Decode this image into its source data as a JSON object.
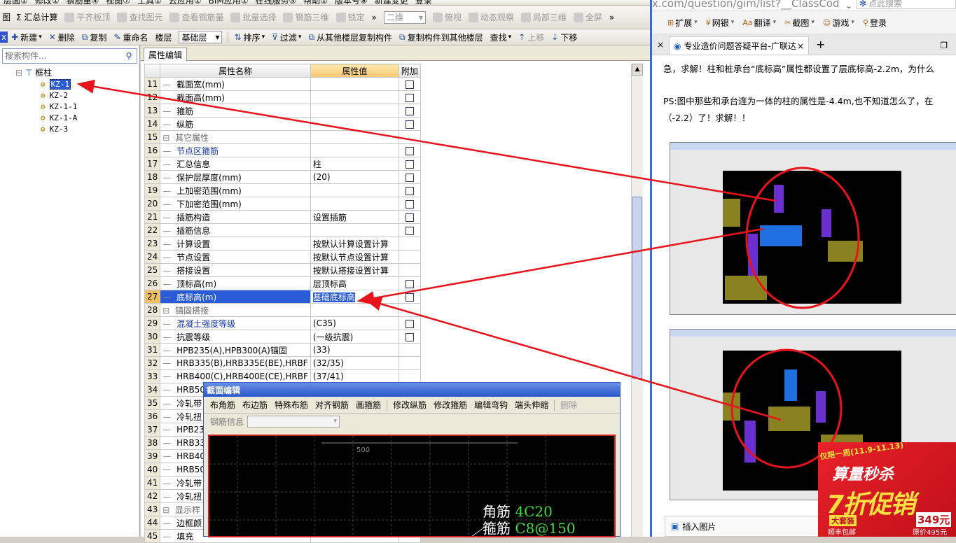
{
  "menu": [
    "层面①",
    "修改①",
    "钢筋量④",
    "视图⑦",
    "工具①",
    "云应用①",
    "BIM应用①",
    "在线服务⑤",
    "帮助①",
    "版本号⑧",
    "新建变更",
    "登录"
  ],
  "toolbar1": {
    "items": [
      "Σ 汇总计算",
      "平齐板顶",
      "查找图元",
      "查看钢筋量",
      "批量选择",
      "钢筋三维",
      "锁定"
    ],
    "view_select": "二维",
    "items2": [
      "俯视",
      "动态观察",
      "局部三维",
      "全屏"
    ],
    "left_glyph": "图"
  },
  "toolbar2": {
    "items": [
      "新建",
      "删除",
      "复制",
      "重命名"
    ],
    "floor_label": "楼层",
    "floor_value": "基础层",
    "items2": [
      "排序",
      "过滤",
      "从其他楼层复制构件",
      "复制构件到其他楼层",
      "查找",
      "上移",
      "下移"
    ]
  },
  "left_panel": {
    "search_placeholder": "搜索构件...",
    "root": "框柱",
    "items": [
      "KZ-1",
      "KZ-2",
      "KZ-1-1",
      "KZ-1-A",
      "KZ-3"
    ],
    "selected_index": 0
  },
  "props": {
    "tab": "属性编辑",
    "headers": [
      "属性名称",
      "属性值",
      "附加"
    ],
    "rows": [
      {
        "n": "11",
        "name": "截面宽(mm)",
        "val": "",
        "cb": true
      },
      {
        "n": "12",
        "name": "截面高(mm)",
        "val": "",
        "cb": true
      },
      {
        "n": "13",
        "name": "箍筋",
        "val": "",
        "cb": true
      },
      {
        "n": "14",
        "name": "纵筋",
        "val": "",
        "cb": true
      },
      {
        "n": "15",
        "name": "其它属性",
        "val": "",
        "cb": false,
        "group": true
      },
      {
        "n": "16",
        "name": "节点区箍筋",
        "val": "",
        "cb": true,
        "blue": true
      },
      {
        "n": "17",
        "name": "汇总信息",
        "val": "柱",
        "cb": true
      },
      {
        "n": "18",
        "name": "保护层厚度(mm)",
        "val": "(20)",
        "cb": true
      },
      {
        "n": "19",
        "name": "上加密范围(mm)",
        "val": "",
        "cb": true
      },
      {
        "n": "20",
        "name": "下加密范围(mm)",
        "val": "",
        "cb": true
      },
      {
        "n": "21",
        "name": "插筋构造",
        "val": "设置插筋",
        "cb": true
      },
      {
        "n": "22",
        "name": "插筋信息",
        "val": "",
        "cb": true
      },
      {
        "n": "23",
        "name": "计算设置",
        "val": "按默认计算设置计算",
        "cb": false
      },
      {
        "n": "24",
        "name": "节点设置",
        "val": "按默认节点设置计算",
        "cb": false
      },
      {
        "n": "25",
        "name": "搭接设置",
        "val": "按默认搭接设置计算",
        "cb": false
      },
      {
        "n": "26",
        "name": "顶标高(m)",
        "val": "层顶标高",
        "cb": true
      },
      {
        "n": "27",
        "name": "底标高(m)",
        "val": "基础底标高",
        "cb": true,
        "selected": true
      },
      {
        "n": "28",
        "name": "锚固搭接",
        "val": "",
        "cb": false,
        "group": true
      },
      {
        "n": "29",
        "name": "混凝土强度等级",
        "val": "(C35)",
        "cb": true,
        "blue": true
      },
      {
        "n": "30",
        "name": "抗震等级",
        "val": "(一级抗震)",
        "cb": true
      },
      {
        "n": "31",
        "name": "HPB235(A),HPB300(A)锚固",
        "val": "(33)",
        "cb": false
      },
      {
        "n": "32",
        "name": "HRB335(B),HRB335E(BE),HRBF",
        "val": "(32/35)",
        "cb": false
      },
      {
        "n": "33",
        "name": "HRB400(C),HRB400E(CE),HRBF",
        "val": "(37/41)",
        "cb": false
      },
      {
        "n": "34",
        "name": "HRB50",
        "val": "",
        "cb": false
      },
      {
        "n": "35",
        "name": "冷轧带",
        "val": "",
        "cb": false
      },
      {
        "n": "36",
        "name": "冷轧扭",
        "val": "",
        "cb": false
      },
      {
        "n": "37",
        "name": "HPB23",
        "val": "",
        "cb": false
      },
      {
        "n": "38",
        "name": "HRB33",
        "val": "",
        "cb": false
      },
      {
        "n": "39",
        "name": "HRB40",
        "val": "",
        "cb": false
      },
      {
        "n": "40",
        "name": "HRB50",
        "val": "",
        "cb": false
      },
      {
        "n": "41",
        "name": "冷轧带",
        "val": "",
        "cb": false
      },
      {
        "n": "42",
        "name": "冷轧扭",
        "val": "",
        "cb": false
      },
      {
        "n": "43",
        "name": "显示样",
        "val": "",
        "cb": false,
        "group": true
      },
      {
        "n": "44",
        "name": "边框颜",
        "val": "",
        "cb": false
      },
      {
        "n": "45",
        "name": "填充",
        "val": "",
        "cb": false
      }
    ]
  },
  "section_editor": {
    "title": "截面编辑",
    "buttons": [
      "布角筋",
      "布边筋",
      "特殊布筋",
      "对齐钢筋",
      "画箍筋",
      "修改纵筋",
      "修改箍筋",
      "编辑弯钩",
      "端头伸缩",
      "删除"
    ],
    "rebar_label": "钢筋信息",
    "dim": "500",
    "corner_label": "角筋",
    "corner_value": "4C20",
    "stirrup_label": "箍筋",
    "stirrup_value": "C8@150"
  },
  "browser": {
    "url": "x.com/question/gim/list?__ClassCod",
    "search_placeholder": "点此搜索",
    "bookmarks": [
      "扩展",
      "网银",
      "翻译",
      "截图",
      "游戏",
      "登录"
    ],
    "tab_title": "专业造价问题答疑平台-广联达",
    "text1": "急，求解！柱和桩承台“底标高”属性都设置了层底标高-2.2m，为什么",
    "text2": "PS:图中那些和承台连为一体的柱的属性是-4.4m,也不知道怎么了，在",
    "text3": "（-2.2）了！求解！！",
    "insert_image": "插入图片",
    "ad": {
      "top": "仅限一周(11.9-11.13)",
      "line1": "算量秒杀",
      "big": "7折促销",
      "bundle": "大套装",
      "shipping": "顺丰包邮",
      "price": "349元",
      "orig": "原价495元"
    }
  },
  "colors": {
    "arrow": "#e8141c",
    "selected": "#2a5bd7",
    "accent_green": "#40e040"
  }
}
